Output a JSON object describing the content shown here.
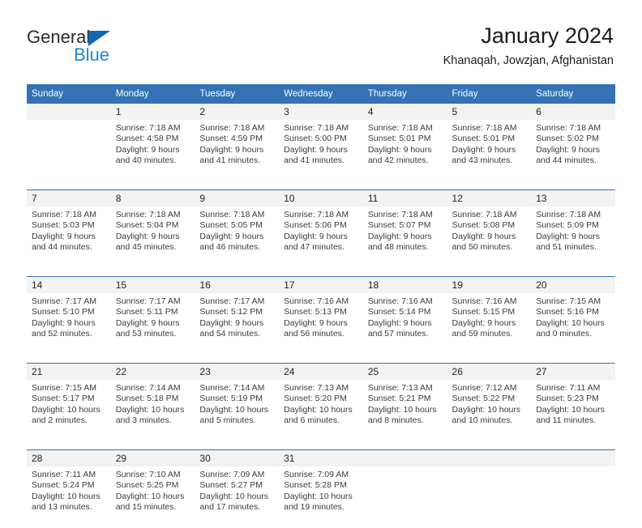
{
  "brand": {
    "name_part1": "General",
    "name_part2": "Blue",
    "color_dark": "#2b2b2b",
    "color_blue": "#1c87d8",
    "triangle_color": "#1268b3"
  },
  "header": {
    "title": "January 2024",
    "subtitle": "Khanaqah, Jowzjan, Afghanistan"
  },
  "theme": {
    "header_bg": "#3372b4",
    "header_text": "#ffffff",
    "daynum_bg": "#f2f2f2",
    "separator": "#3372b4"
  },
  "calendar": {
    "weekdays": [
      "Sunday",
      "Monday",
      "Tuesday",
      "Wednesday",
      "Thursday",
      "Friday",
      "Saturday"
    ],
    "weeks": [
      [
        {
          "day": "",
          "lines": []
        },
        {
          "day": "1",
          "lines": [
            "Sunrise: 7:18 AM",
            "Sunset: 4:58 PM",
            "Daylight: 9 hours",
            "and 40 minutes."
          ]
        },
        {
          "day": "2",
          "lines": [
            "Sunrise: 7:18 AM",
            "Sunset: 4:59 PM",
            "Daylight: 9 hours",
            "and 41 minutes."
          ]
        },
        {
          "day": "3",
          "lines": [
            "Sunrise: 7:18 AM",
            "Sunset: 5:00 PM",
            "Daylight: 9 hours",
            "and 41 minutes."
          ]
        },
        {
          "day": "4",
          "lines": [
            "Sunrise: 7:18 AM",
            "Sunset: 5:01 PM",
            "Daylight: 9 hours",
            "and 42 minutes."
          ]
        },
        {
          "day": "5",
          "lines": [
            "Sunrise: 7:18 AM",
            "Sunset: 5:01 PM",
            "Daylight: 9 hours",
            "and 43 minutes."
          ]
        },
        {
          "day": "6",
          "lines": [
            "Sunrise: 7:18 AM",
            "Sunset: 5:02 PM",
            "Daylight: 9 hours",
            "and 44 minutes."
          ]
        }
      ],
      [
        {
          "day": "7",
          "lines": [
            "Sunrise: 7:18 AM",
            "Sunset: 5:03 PM",
            "Daylight: 9 hours",
            "and 44 minutes."
          ]
        },
        {
          "day": "8",
          "lines": [
            "Sunrise: 7:18 AM",
            "Sunset: 5:04 PM",
            "Daylight: 9 hours",
            "and 45 minutes."
          ]
        },
        {
          "day": "9",
          "lines": [
            "Sunrise: 7:18 AM",
            "Sunset: 5:05 PM",
            "Daylight: 9 hours",
            "and 46 minutes."
          ]
        },
        {
          "day": "10",
          "lines": [
            "Sunrise: 7:18 AM",
            "Sunset: 5:06 PM",
            "Daylight: 9 hours",
            "and 47 minutes."
          ]
        },
        {
          "day": "11",
          "lines": [
            "Sunrise: 7:18 AM",
            "Sunset: 5:07 PM",
            "Daylight: 9 hours",
            "and 48 minutes."
          ]
        },
        {
          "day": "12",
          "lines": [
            "Sunrise: 7:18 AM",
            "Sunset: 5:08 PM",
            "Daylight: 9 hours",
            "and 50 minutes."
          ]
        },
        {
          "day": "13",
          "lines": [
            "Sunrise: 7:18 AM",
            "Sunset: 5:09 PM",
            "Daylight: 9 hours",
            "and 51 minutes."
          ]
        }
      ],
      [
        {
          "day": "14",
          "lines": [
            "Sunrise: 7:17 AM",
            "Sunset: 5:10 PM",
            "Daylight: 9 hours",
            "and 52 minutes."
          ]
        },
        {
          "day": "15",
          "lines": [
            "Sunrise: 7:17 AM",
            "Sunset: 5:11 PM",
            "Daylight: 9 hours",
            "and 53 minutes."
          ]
        },
        {
          "day": "16",
          "lines": [
            "Sunrise: 7:17 AM",
            "Sunset: 5:12 PM",
            "Daylight: 9 hours",
            "and 54 minutes."
          ]
        },
        {
          "day": "17",
          "lines": [
            "Sunrise: 7:16 AM",
            "Sunset: 5:13 PM",
            "Daylight: 9 hours",
            "and 56 minutes."
          ]
        },
        {
          "day": "18",
          "lines": [
            "Sunrise: 7:16 AM",
            "Sunset: 5:14 PM",
            "Daylight: 9 hours",
            "and 57 minutes."
          ]
        },
        {
          "day": "19",
          "lines": [
            "Sunrise: 7:16 AM",
            "Sunset: 5:15 PM",
            "Daylight: 9 hours",
            "and 59 minutes."
          ]
        },
        {
          "day": "20",
          "lines": [
            "Sunrise: 7:15 AM",
            "Sunset: 5:16 PM",
            "Daylight: 10 hours",
            "and 0 minutes."
          ]
        }
      ],
      [
        {
          "day": "21",
          "lines": [
            "Sunrise: 7:15 AM",
            "Sunset: 5:17 PM",
            "Daylight: 10 hours",
            "and 2 minutes."
          ]
        },
        {
          "day": "22",
          "lines": [
            "Sunrise: 7:14 AM",
            "Sunset: 5:18 PM",
            "Daylight: 10 hours",
            "and 3 minutes."
          ]
        },
        {
          "day": "23",
          "lines": [
            "Sunrise: 7:14 AM",
            "Sunset: 5:19 PM",
            "Daylight: 10 hours",
            "and 5 minutes."
          ]
        },
        {
          "day": "24",
          "lines": [
            "Sunrise: 7:13 AM",
            "Sunset: 5:20 PM",
            "Daylight: 10 hours",
            "and 6 minutes."
          ]
        },
        {
          "day": "25",
          "lines": [
            "Sunrise: 7:13 AM",
            "Sunset: 5:21 PM",
            "Daylight: 10 hours",
            "and 8 minutes."
          ]
        },
        {
          "day": "26",
          "lines": [
            "Sunrise: 7:12 AM",
            "Sunset: 5:22 PM",
            "Daylight: 10 hours",
            "and 10 minutes."
          ]
        },
        {
          "day": "27",
          "lines": [
            "Sunrise: 7:11 AM",
            "Sunset: 5:23 PM",
            "Daylight: 10 hours",
            "and 11 minutes."
          ]
        }
      ],
      [
        {
          "day": "28",
          "lines": [
            "Sunrise: 7:11 AM",
            "Sunset: 5:24 PM",
            "Daylight: 10 hours",
            "and 13 minutes."
          ]
        },
        {
          "day": "29",
          "lines": [
            "Sunrise: 7:10 AM",
            "Sunset: 5:25 PM",
            "Daylight: 10 hours",
            "and 15 minutes."
          ]
        },
        {
          "day": "30",
          "lines": [
            "Sunrise: 7:09 AM",
            "Sunset: 5:27 PM",
            "Daylight: 10 hours",
            "and 17 minutes."
          ]
        },
        {
          "day": "31",
          "lines": [
            "Sunrise: 7:09 AM",
            "Sunset: 5:28 PM",
            "Daylight: 10 hours",
            "and 19 minutes."
          ]
        },
        {
          "day": "",
          "lines": []
        },
        {
          "day": "",
          "lines": []
        },
        {
          "day": "",
          "lines": []
        }
      ]
    ]
  }
}
